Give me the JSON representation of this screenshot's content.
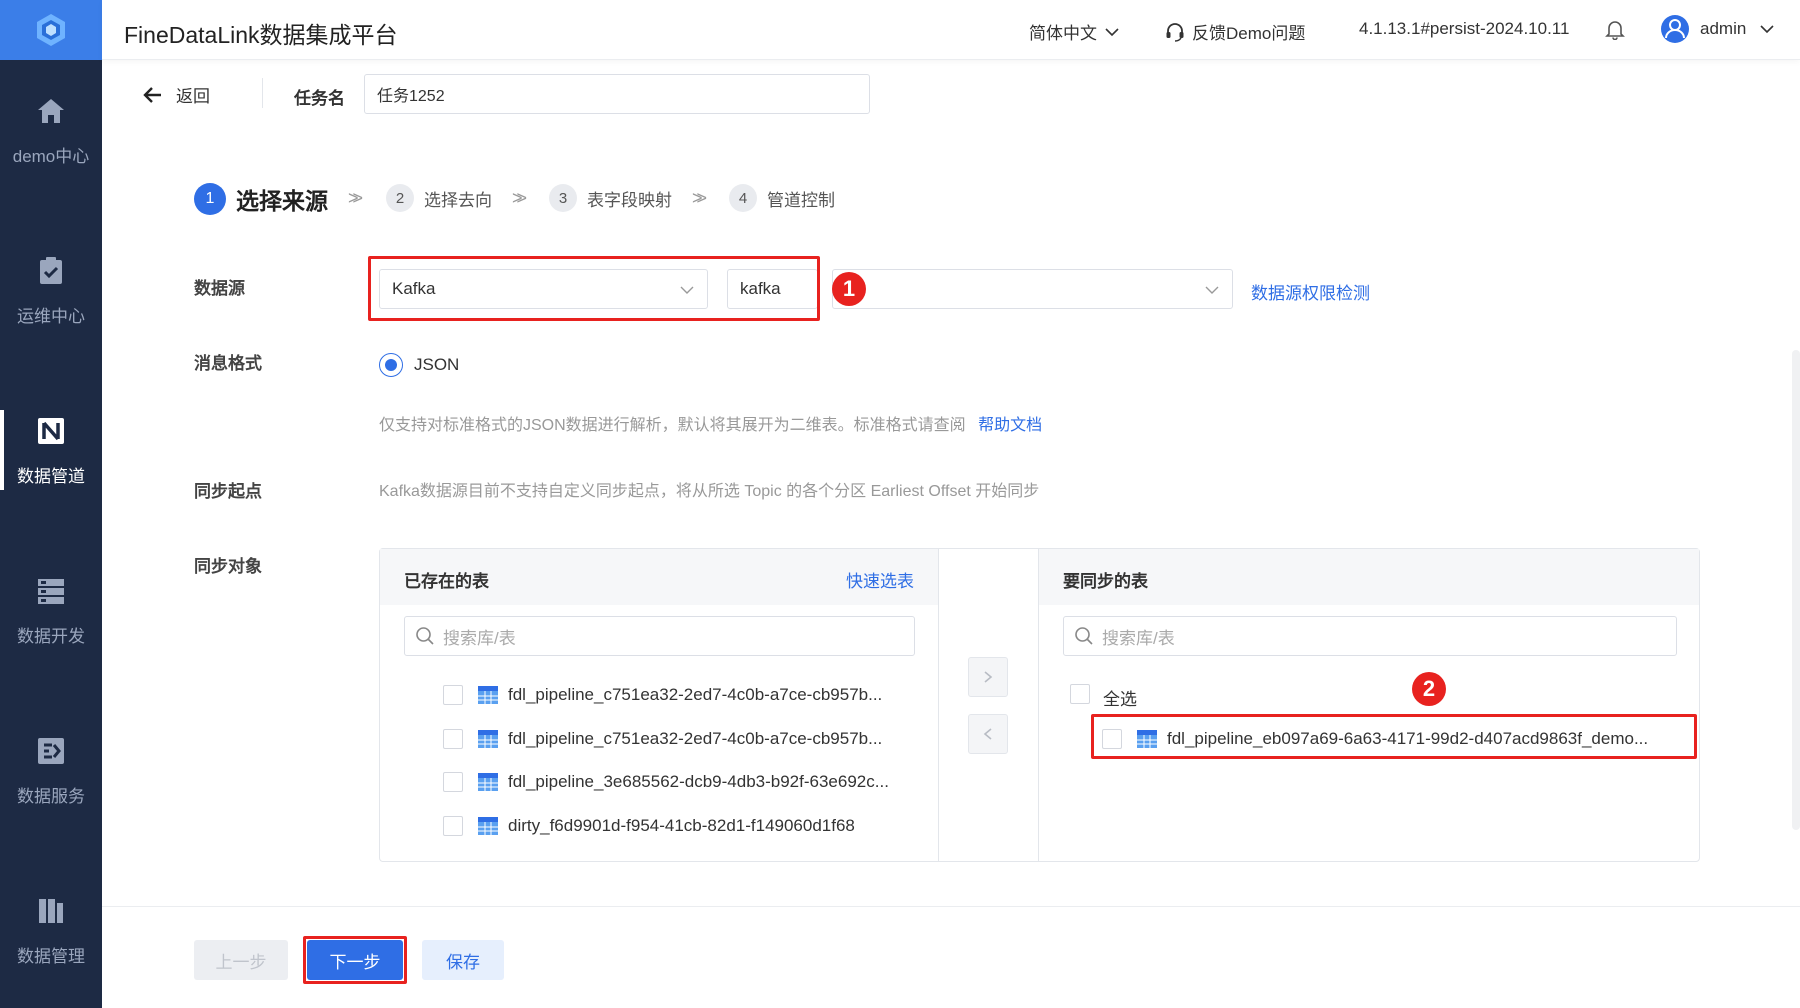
{
  "header": {
    "app_title": "FineDataLink数据集成平台",
    "language": "简体中文",
    "feedback": "反馈Demo问题",
    "version": "4.1.13.1#persist-2024.10.11",
    "user": "admin"
  },
  "sidebar": {
    "items": [
      {
        "label": "demo中心"
      },
      {
        "label": "运维中心"
      },
      {
        "label": "数据管道"
      },
      {
        "label": "数据开发"
      },
      {
        "label": "数据服务"
      },
      {
        "label": "数据管理"
      }
    ]
  },
  "task": {
    "back_label": "返回",
    "name_label": "任务名",
    "name_value": "任务1252"
  },
  "steps": [
    {
      "num": "1",
      "label": "选择来源"
    },
    {
      "num": "2",
      "label": "选择去向"
    },
    {
      "num": "3",
      "label": "表字段映射"
    },
    {
      "num": "4",
      "label": "管道控制"
    }
  ],
  "form": {
    "datasource_label": "数据源",
    "datasource_type": "Kafka",
    "datasource_name": "kafka",
    "permission_check": "数据源权限检测",
    "format_label": "消息格式",
    "format_option": "JSON",
    "format_hint": "仅支持对标准格式的JSON数据进行解析，默认将其展开为二维表。标准格式请查阅",
    "help_doc": "帮助文档",
    "sync_start_label": "同步起点",
    "sync_start_hint": "Kafka数据源目前不支持自定义同步起点，将从所选 Topic 的各个分区 Earliest Offset 开始同步",
    "sync_object_label": "同步对象"
  },
  "transfer": {
    "left_title": "已存在的表",
    "quick_select": "快速选表",
    "left_search_placeholder": "搜索库/表",
    "left_items": [
      "fdl_pipeline_c751ea32-2ed7-4c0b-a7ce-cb957b...",
      "fdl_pipeline_c751ea32-2ed7-4c0b-a7ce-cb957b...",
      "fdl_pipeline_3e685562-dcb9-4db3-b92f-63e692c...",
      "dirty_f6d9901d-f954-41cb-82d1-f149060d1f68"
    ],
    "right_title": "要同步的表",
    "right_search_placeholder": "搜索库/表",
    "select_all": "全选",
    "right_items": [
      "fdl_pipeline_eb097a69-6a63-4171-99d2-d407acd9863f_demo..."
    ]
  },
  "annotations": {
    "badge1": "1",
    "badge2": "2"
  },
  "footer": {
    "prev": "上一步",
    "next": "下一步",
    "save": "保存"
  },
  "colors": {
    "primary": "#2f6ee5",
    "sidebar": "#1d2a44",
    "highlight": "#e8221f"
  }
}
